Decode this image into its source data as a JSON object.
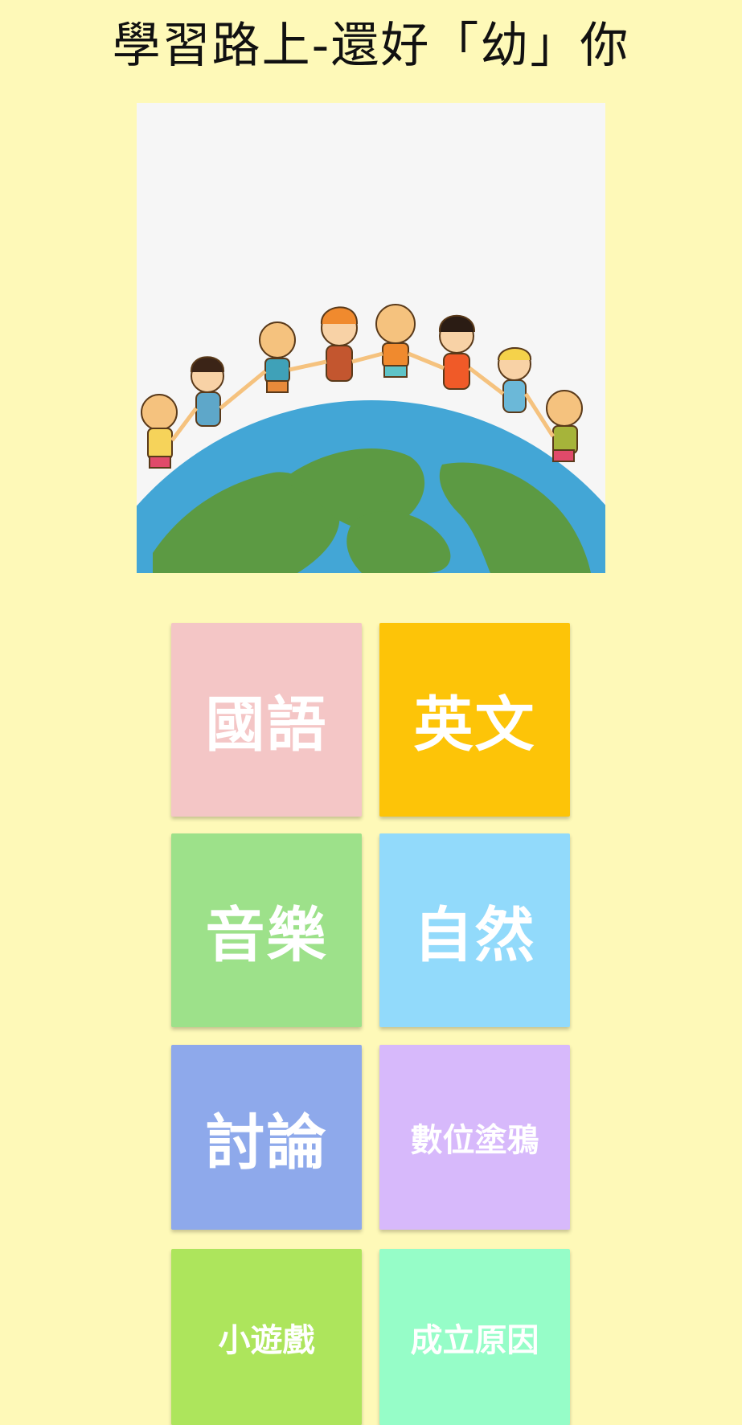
{
  "app": {
    "title": "學習路上-還好「幼」你"
  },
  "hero": {
    "description_icon": "kids-around-globe-illustration"
  },
  "menu": {
    "tiles": [
      {
        "label": "國語",
        "color": "#F4C6C6"
      },
      {
        "label": "英文",
        "color": "#FDC408"
      },
      {
        "label": "音樂",
        "color": "#9DE18A"
      },
      {
        "label": "自然",
        "color": "#92DAFB"
      },
      {
        "label": "討論",
        "color": "#8EA9EB"
      },
      {
        "label": "數位塗鴉",
        "color": "#D7B9FB"
      },
      {
        "label": "小遊戲",
        "color": "#ADE55C"
      },
      {
        "label": "成立原因",
        "color": "#96FDC8"
      }
    ]
  }
}
